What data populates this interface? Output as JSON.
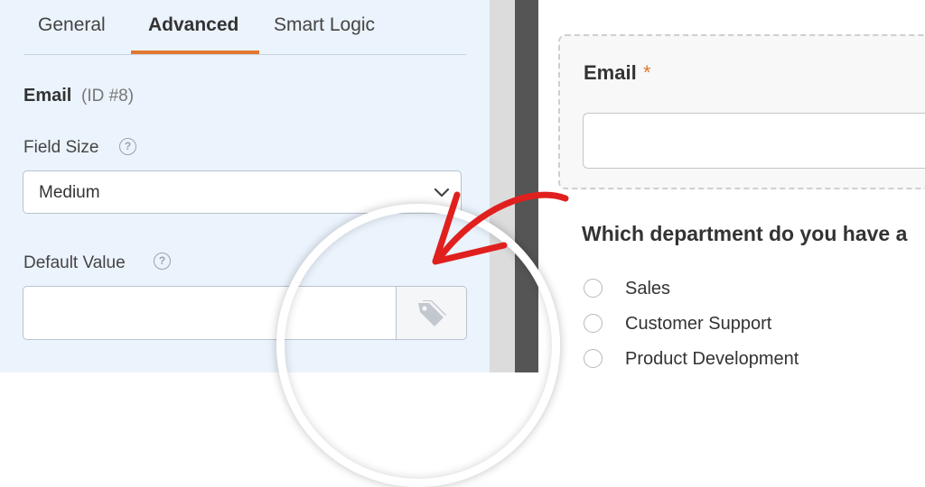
{
  "tabs": [
    "General",
    "Advanced",
    "Smart Logic"
  ],
  "field": {
    "title": "Email",
    "id": "(ID #8)",
    "size_label": "Field Size",
    "size_value": "Medium",
    "default_value_label": "Default Value",
    "help_glyph": "?"
  },
  "preview": {
    "email_label": "Email",
    "required_mark": "*",
    "question": "Which department do you have a",
    "options": [
      "Sales",
      "Customer Support",
      "Product Development"
    ]
  },
  "colors": {
    "accent": "#e27730",
    "annotation_arrow": "#e0201e",
    "panel_bg": "#ebf3fc"
  },
  "icons": {
    "select_caret": "chevron-down-icon",
    "smart_tags": "tags-icon",
    "help": "help-circle-icon"
  }
}
